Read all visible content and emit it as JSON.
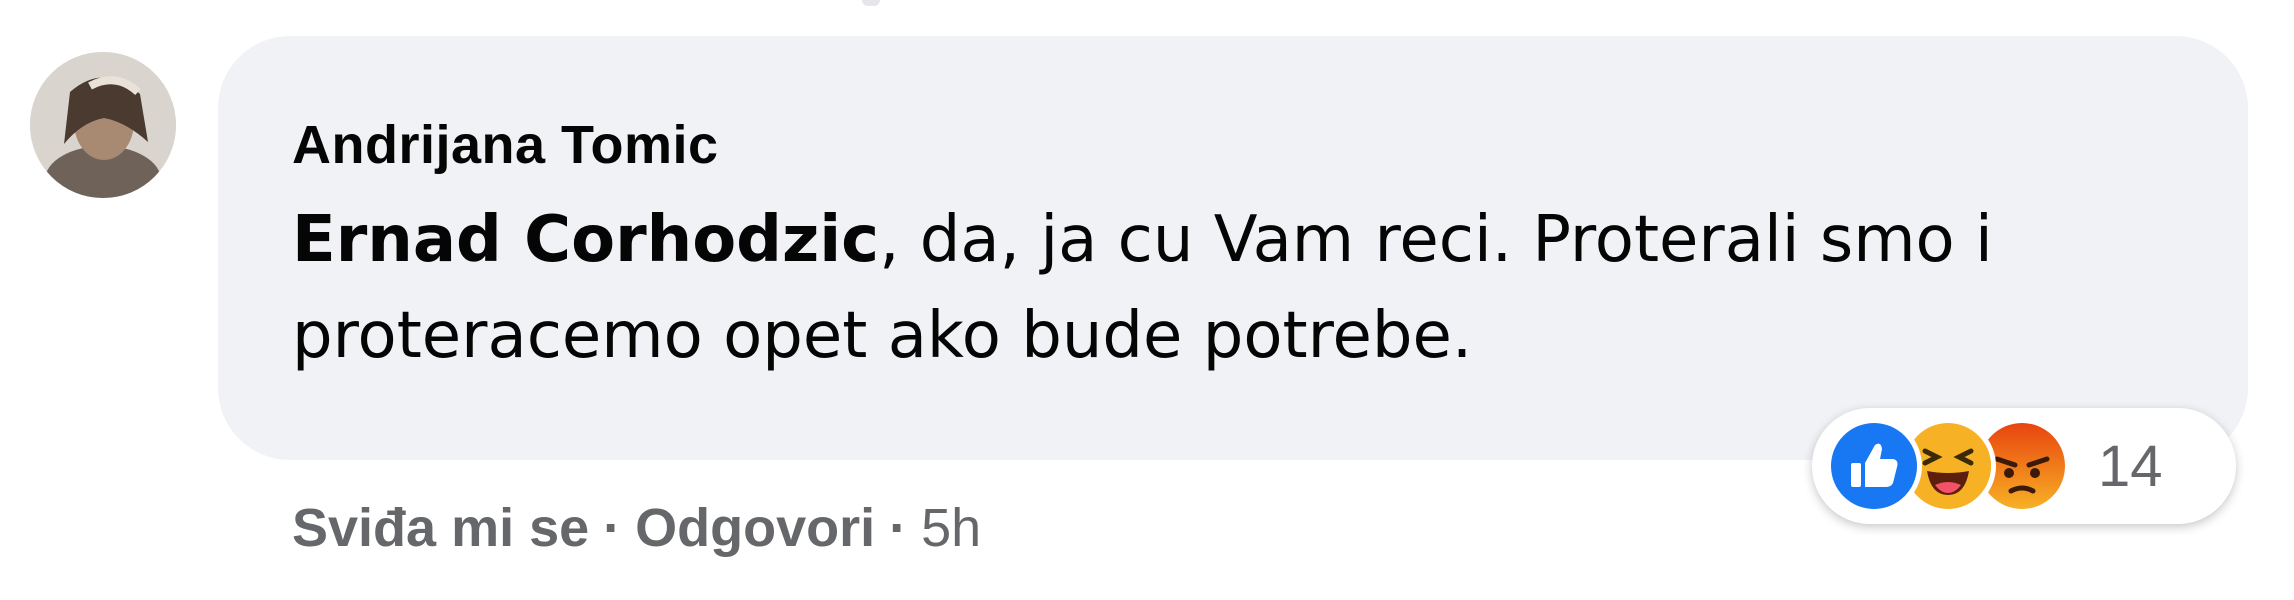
{
  "comment": {
    "author": "Andrijana Tomic",
    "mention": "Ernad Corhodzic",
    "text": ", da, ja cu Vam reci. Proterali smo i proteracemo opet ako bude potrebe."
  },
  "reactions": {
    "icons": [
      "like-icon",
      "haha-icon",
      "angry-icon"
    ],
    "count": "14",
    "colors": {
      "like": "#1877f2",
      "haha": "#f7b125",
      "angry": "#e9710f"
    }
  },
  "actions": {
    "like_label": "Sviđa mi se",
    "separator": "·",
    "reply_label": "Odgovori",
    "time": "5h"
  }
}
